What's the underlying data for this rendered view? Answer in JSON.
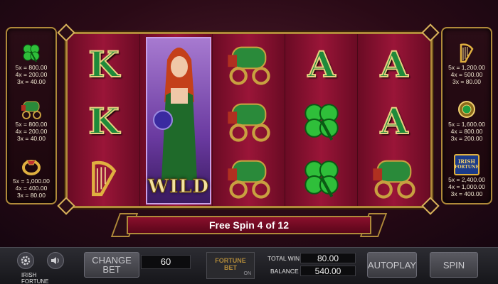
{
  "game": {
    "name": "IRISH FORTUNE"
  },
  "paytable_left": [
    {
      "icon": "clover-icon",
      "lines": [
        "5x = 800.00",
        "4x = 200.00",
        "3x = 40.00"
      ]
    },
    {
      "icon": "wagon-icon",
      "lines": [
        "5x = 800.00",
        "4x = 200.00",
        "3x = 40.00"
      ]
    },
    {
      "icon": "ring-icon",
      "lines": [
        "5x = 1,000.00",
        "4x = 400.00",
        "3x = 80.00"
      ]
    }
  ],
  "paytable_right": [
    {
      "icon": "harp-icon",
      "lines": [
        "5x = 1,200.00",
        "4x = 500.00",
        "3x = 80.00"
      ]
    },
    {
      "icon": "brooch-icon",
      "lines": [
        "5x = 1,600.00",
        "4x = 800.00",
        "3x = 200.00"
      ]
    },
    {
      "icon": "logo-icon",
      "logo_text": [
        "IRISH",
        "FORTUNE"
      ],
      "lines": [
        "5x = 2,400.00",
        "4x = 1,000.00",
        "3x = 400.00"
      ]
    }
  ],
  "reels": {
    "reel1": [
      "K",
      "K",
      "harp"
    ],
    "reel2_wild": "WILD",
    "reel3": [
      "wagon",
      "wagon",
      "wagon"
    ],
    "reel4": [
      "A",
      "clover",
      "clover"
    ],
    "reel5": [
      "A",
      "A",
      "wagon"
    ]
  },
  "banner": {
    "text": "Free Spin 4 of 12"
  },
  "controls": {
    "change_bet_label": "CHANGE\nBET",
    "bet_value": "60",
    "fortune_bet_label_1": "FORTUNE",
    "fortune_bet_label_2": "BET",
    "fortune_bet_state": "ON",
    "total_win_label": "TOTAL WIN",
    "total_win_value": "80.00",
    "balance_label": "BALANCE",
    "balance_value": "540.00",
    "autoplay_label": "AUTOPLAY",
    "spin_label": "SPIN"
  },
  "colors": {
    "accent_gold": "#b08a3a",
    "reel_red": "#9a1538",
    "letter_green": "#1f8a3a"
  }
}
